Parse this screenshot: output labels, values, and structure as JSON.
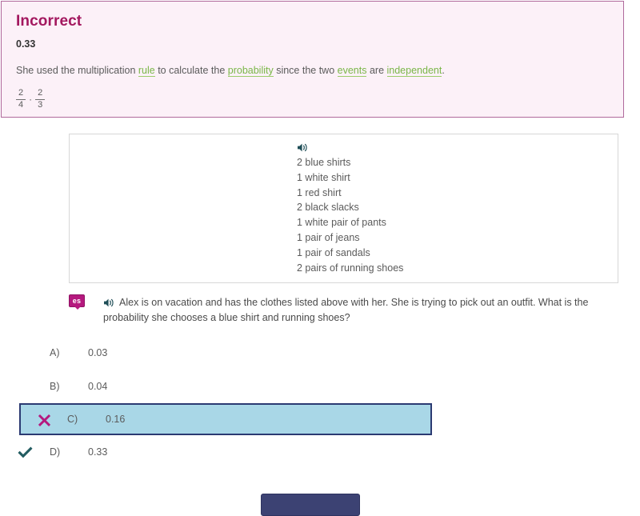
{
  "feedback": {
    "title": "Incorrect",
    "correct_answer": "0.33",
    "explanation_parts": [
      {
        "text": "She used the multiplication ",
        "type": "plain"
      },
      {
        "text": "rule",
        "type": "link"
      },
      {
        "text": " to calculate the ",
        "type": "plain"
      },
      {
        "text": "probability",
        "type": "link"
      },
      {
        "text": " since the two ",
        "type": "plain"
      },
      {
        "text": "events",
        "type": "link"
      },
      {
        "text": " are ",
        "type": "plain"
      },
      {
        "text": "independent",
        "type": "link"
      },
      {
        "text": ".",
        "type": "plain"
      }
    ],
    "explanation_plain": "She used the multiplication rule to calculate the probability since the two events are independent.",
    "links": {
      "rule": "rule",
      "probability": "probability",
      "events": "events",
      "independent": "independent"
    },
    "math": {
      "fraction1": {
        "numerator": "2",
        "denominator": "4"
      },
      "operator": "·",
      "fraction2": {
        "numerator": "2",
        "denominator": "3"
      }
    },
    "colors": {
      "panel_background": "#fcf1f8",
      "panel_border": "#b06a9c",
      "title_color": "#a3185f",
      "link_color": "#7ab648"
    }
  },
  "stimulus": {
    "audio_icon": "speaker-icon",
    "items": [
      "2 blue shirts",
      "1 white shirt",
      "1 red shirt",
      "2 black slacks",
      "1 white pair of pants",
      "1 pair of jeans",
      "1 pair of sandals",
      "2 pairs of running shoes"
    ]
  },
  "question": {
    "translate_badge": "es",
    "audio_icon": "speaker-icon",
    "text": "Alex is on vacation and has the clothes listed above with her. She is trying to pick out an outfit. What is the probability she chooses a blue shirt and running shoes?"
  },
  "options": [
    {
      "letter": "A)",
      "value": "0.03",
      "mark": "none",
      "selected": false
    },
    {
      "letter": "B)",
      "value": "0.04",
      "mark": "none",
      "selected": false
    },
    {
      "letter": "C)",
      "value": "0.16",
      "mark": "incorrect",
      "selected": true
    },
    {
      "letter": "D)",
      "value": "0.33",
      "mark": "correct",
      "selected": false
    }
  ],
  "option_colors": {
    "selected_background": "#a9d7e7",
    "selected_border": "#2b3a72",
    "incorrect_mark": "#b5197e",
    "correct_mark": "#225c61"
  },
  "submit": {
    "label": "",
    "color": "#3c4273"
  }
}
